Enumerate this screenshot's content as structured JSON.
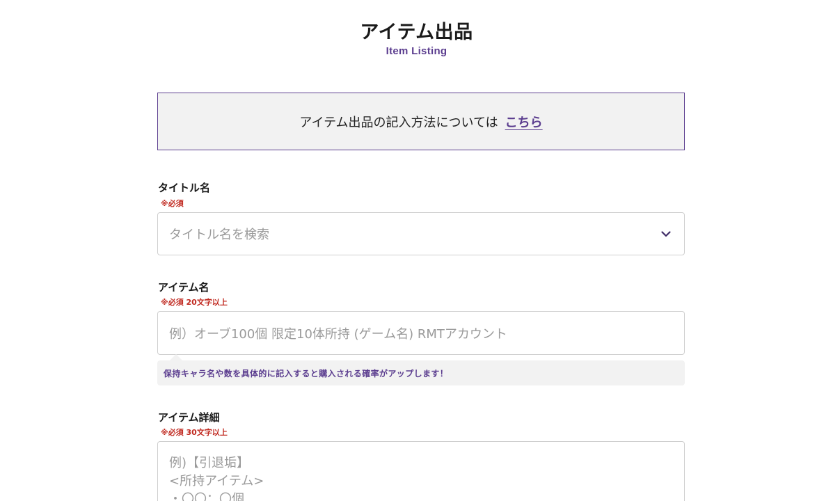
{
  "header": {
    "title": "アイテム出品",
    "subtitle": "Item Listing"
  },
  "notice": {
    "text": "アイテム出品の記入方法については",
    "link_label": "こちら"
  },
  "title_field": {
    "label": "タイトル名",
    "required": "※必須",
    "placeholder": "タイトル名を検索",
    "icon": "chevron-down-icon"
  },
  "item_name_field": {
    "label": "アイテム名",
    "required": "※必須 20文字以上",
    "placeholder": "例）オーブ100個 限定10体所持 (ゲーム名) RMTアカウント",
    "hint": "保持キャラ名や数を具体的に記入すると購入される確率がアップします！"
  },
  "item_detail_field": {
    "label": "アイテム詳細",
    "required": "※必須 30文字以上",
    "placeholder_lines": [
      "例)【引退垢】",
      "<所持アイテム>",
      "・〇〇：〇個"
    ]
  },
  "colors": {
    "accent": "#5b3d8f",
    "required": "#c0281f",
    "panel_bg": "#f2f2f2"
  }
}
